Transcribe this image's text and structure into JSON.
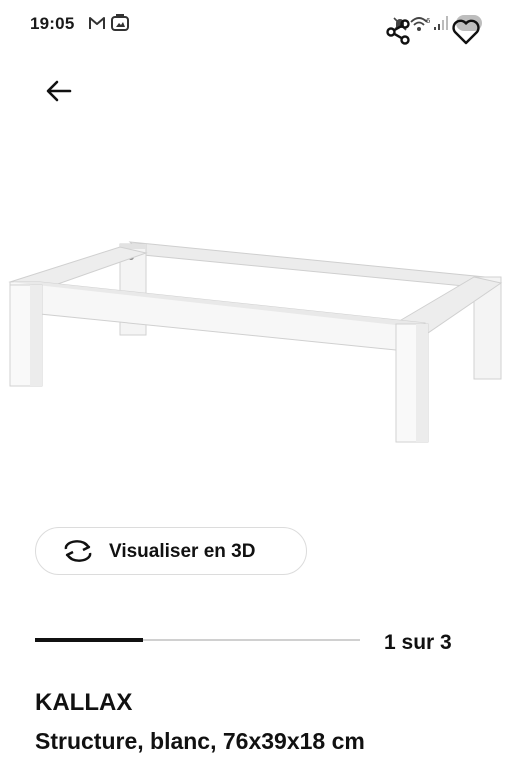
{
  "status_bar": {
    "time": "19:05",
    "notification_icons": [
      "gmail-icon",
      "gallery-icon"
    ],
    "system_icons": [
      "mute-icon",
      "wifi-6-icon",
      "signal-icon",
      "battery-icon"
    ]
  },
  "header": {
    "back_icon": "arrow-left-icon",
    "share_icon": "share-icon",
    "favorite_icon": "heart-icon"
  },
  "gallery": {
    "view_3d_label": "Visualiser en 3D",
    "view_3d_icon": "rotate-3d-icon",
    "pager_text": "1 sur 3",
    "current_page": 1,
    "total_pages": 3
  },
  "product": {
    "name": "KALLAX",
    "description": "Structure, blanc, 76x39x18 cm"
  }
}
